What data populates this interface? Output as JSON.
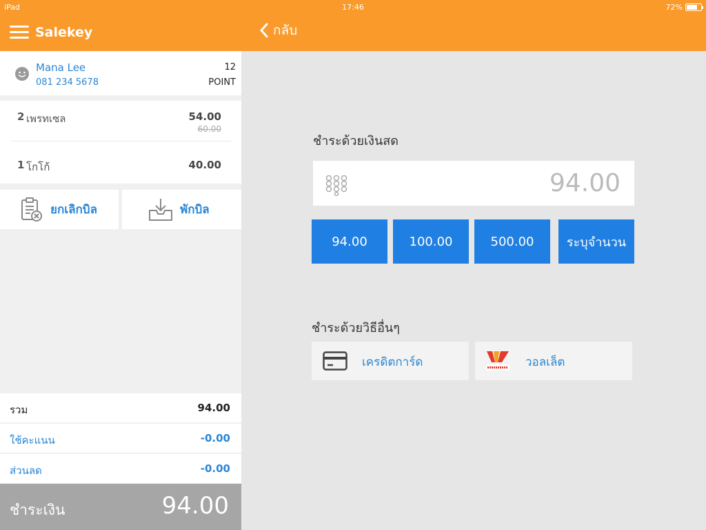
{
  "status_bar": {
    "device": "iPad",
    "time": "17:46",
    "battery": "72%"
  },
  "header": {
    "app_title": "Salekey",
    "back_label": "กลับ"
  },
  "customer": {
    "name": "Mana Lee",
    "phone": "081 234 5678",
    "points": "12",
    "points_label": "POINT"
  },
  "cart": {
    "items": [
      {
        "qty": "2",
        "name": "เพรทเซล",
        "price": "54.00",
        "original_price": "60.00"
      },
      {
        "qty": "1",
        "name": "โกโก้",
        "price": "40.00"
      }
    ]
  },
  "actions": {
    "cancel_label": "ยกเลิกบิล",
    "hold_label": "พักบิล"
  },
  "summary": {
    "total_label": "รวม",
    "total_value": "94.00",
    "points_label": "ใช้คะแนน",
    "points_value": "-0.00",
    "discount_label": "ส่วนลด",
    "discount_value": "-0.00",
    "pay_label": "ชำระเงิน",
    "pay_value": "94.00"
  },
  "cash_payment": {
    "heading": "ชำระด้วยเงินสด",
    "amount_placeholder": "94.00",
    "quick_amounts": [
      "94.00",
      "100.00",
      "500.00"
    ],
    "custom_label": "ระบุจำนวน"
  },
  "other_payment": {
    "heading": "ชำระด้วยวิธีอื่นๆ",
    "methods": [
      {
        "label": "เครดิตการ์ด",
        "icon": "credit-card-icon"
      },
      {
        "label": "วอลเล็ต",
        "icon": "truemoney-wallet-icon"
      }
    ]
  },
  "colors": {
    "header": "#f99a2a",
    "accent_blue": "#1f7fe2",
    "link_blue": "#2a86d5",
    "pay_bar": "#a6a6a6"
  }
}
